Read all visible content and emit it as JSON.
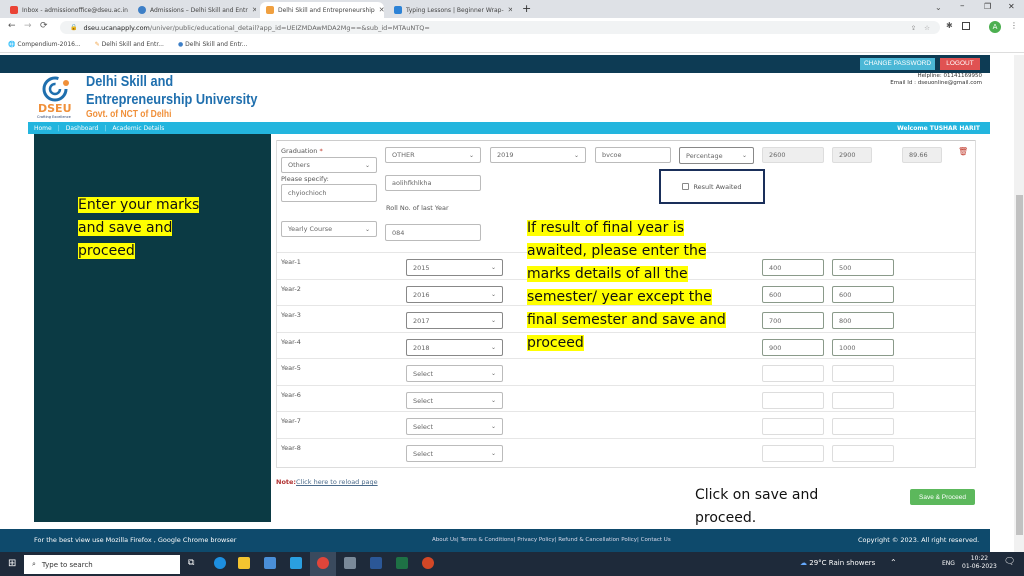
{
  "browser": {
    "tabs": [
      {
        "title": "Inbox - admissionoffice@dseu.ac.in",
        "active": false
      },
      {
        "title": "Admissions – Delhi Skill and Entr",
        "active": false
      },
      {
        "title": "Delhi Skill and Entrepreneurship",
        "active": true
      },
      {
        "title": "Typing Lessons | Beginner Wrap-",
        "active": false
      }
    ],
    "new_tab": "+",
    "url_host": "dseu.ucanapply.com",
    "url_path": "/univer/public/educational_detail?app_id=UEIZMDAwMDA2Mg==&sub_id=MTAuNTQ=",
    "profile_initial": "A",
    "bookmarks": [
      "Compendium-2016...",
      "Delhi Skill and Entr...",
      "Delhi Skill and Entr..."
    ]
  },
  "header": {
    "change_password": "CHANGE PASSWORD",
    "logout": "LOGOUT",
    "brand_line1": "Delhi Skill and",
    "brand_line2": "Entrepreneurship University",
    "brand_line3": "Govt. of NCT of Delhi",
    "logo_text": "DSEU",
    "logo_tagline": "Crafting Excellence",
    "helpline": "Helpline: 01141169950",
    "email": "Email Id : dseuonline@gmail.com"
  },
  "nav": {
    "items": [
      "Home",
      "Dashboard",
      "Academic Details"
    ],
    "welcome": "Welcome TUSHAR HARIT"
  },
  "form": {
    "graduation_label": "Graduation",
    "required_mark": "*",
    "graduation_value": "Others",
    "board_value": "OTHER",
    "year_value": "2019",
    "institute_value": "bvcoe",
    "grading_value": "Percentage",
    "obtained_marks": "2600",
    "max_marks": "2900",
    "percentage": "89.66",
    "please_specify_label": "Please specify:",
    "please_specify_value": "chyiochioch",
    "other_field_value": "aolihfkhlkha",
    "result_awaited_label": "Result Awaited",
    "roll_no_label": "Roll No. of last Year",
    "roll_no_value": "084",
    "course_type_value": "Yearly Course",
    "years": [
      {
        "label": "Year-1",
        "year": "2015",
        "obtained": "400",
        "max": "500"
      },
      {
        "label": "Year-2",
        "year": "2016",
        "obtained": "600",
        "max": "600"
      },
      {
        "label": "Year-3",
        "year": "2017",
        "obtained": "700",
        "max": "800"
      },
      {
        "label": "Year-4",
        "year": "2018",
        "obtained": "900",
        "max": "1000"
      },
      {
        "label": "Year-5",
        "year": "Select",
        "obtained": "",
        "max": ""
      },
      {
        "label": "Year-6",
        "year": "Select",
        "obtained": "",
        "max": ""
      },
      {
        "label": "Year-7",
        "year": "Select",
        "obtained": "",
        "max": ""
      },
      {
        "label": "Year-8",
        "year": "Select",
        "obtained": "",
        "max": ""
      }
    ],
    "note_label": "Note:",
    "reload_link": "Click here to reload page",
    "save_button": "Save & Proceed"
  },
  "annotations": {
    "left": "Enter your marks and save and proceed",
    "center": "If result of final year is awaited, please enter the marks details of all the semester/ year except the final semester and save and proceed",
    "bottom": "Click on save and proceed."
  },
  "footer": {
    "browser_note": "For the best view use Mozilla Firefox , Google Chrome browser",
    "links": "About Us| Terms & Conditions| Privacy Policy| Refund & Cancellation Policy| Contact Us",
    "copyright": "Copyright © 2023. All right reserved."
  },
  "taskbar": {
    "search_placeholder": "Type to search",
    "weather": "29°C  Rain showers",
    "language": "ENG",
    "time": "10:22",
    "date": "01-06-2023",
    "notifications": "2"
  },
  "colors": {
    "nav_bar": "#23b5de",
    "top_strip": "#0d3b54",
    "sidebar": "#0b3a44",
    "save_button": "#5cb85c",
    "logout": "#e05252",
    "highlight": "#ffff00"
  }
}
